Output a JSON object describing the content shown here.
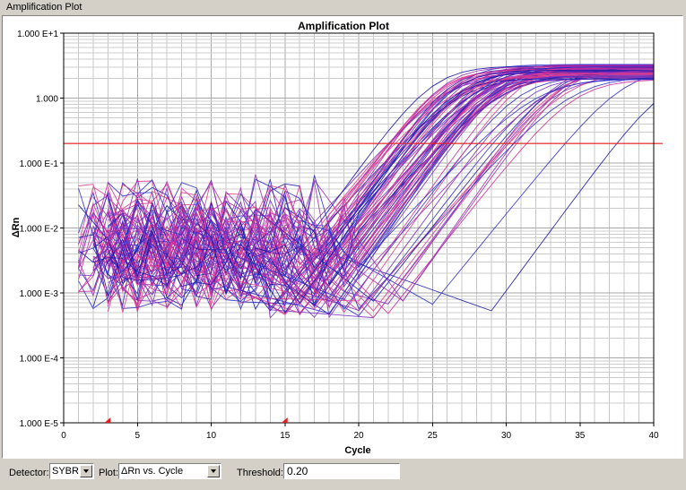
{
  "window": {
    "title": "Amplification Plot"
  },
  "chart_data": {
    "type": "line",
    "title": "Amplification Plot",
    "xlabel": "Cycle",
    "ylabel": "ΔRn",
    "xlim": [
      0,
      40
    ],
    "ylim": [
      1e-05,
      10
    ],
    "yscale": "log",
    "grid": true,
    "x_ticks": [
      "0",
      "5",
      "10",
      "15",
      "20",
      "25",
      "30",
      "35",
      "40"
    ],
    "y_ticks": [
      "1.000 E+1",
      "1.000",
      "1.000 E-1",
      "1.000 E-2",
      "1.000 E-3",
      "1.000 E-4",
      "1.000 E-5"
    ],
    "threshold": 0.2,
    "threshold_color": "#e02020",
    "baseline_markers": [
      3,
      15
    ],
    "series_colors": [
      "#1a1aa8",
      "#3030c8",
      "#7a2fc0",
      "#a030b0",
      "#d02a9a",
      "#e03c8c"
    ],
    "curve_count": 80,
    "ct_range": [
      19,
      38
    ],
    "plateau_range": [
      1.9,
      3.3
    ]
  },
  "bottom_bar": {
    "detector_label": "Detector:",
    "detector_value": "SYBR",
    "plot_label": "Plot:",
    "plot_value": "ΔRn vs. Cycle",
    "threshold_label": "Threshold:",
    "threshold_value": "0.20"
  }
}
